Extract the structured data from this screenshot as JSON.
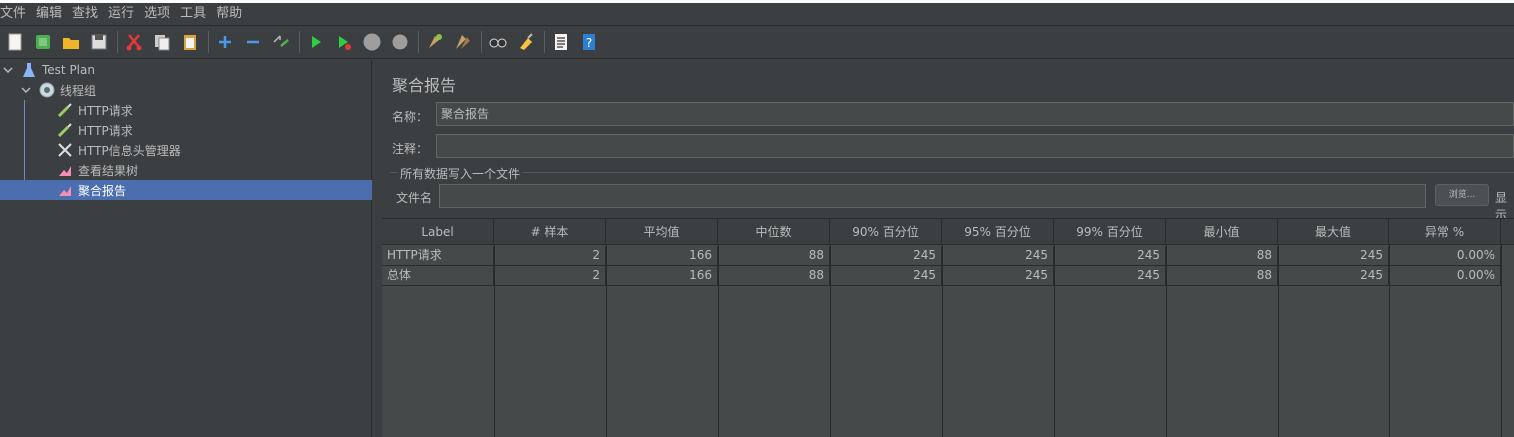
{
  "menu": [
    "文件",
    "编辑",
    "查找",
    "运行",
    "选项",
    "工具",
    "帮助"
  ],
  "toolbar": {
    "icons": [
      "new-icon",
      "templates-icon",
      "open-icon",
      "save-icon",
      "cut-icon",
      "copy-icon",
      "paste-icon",
      "expand-icon",
      "collapse-icon",
      "toggle-icon",
      "start-icon",
      "start-no-pauses-icon",
      "stop-icon",
      "shutdown-icon",
      "clear-icon",
      "clear-all-icon",
      "search-icon",
      "reset-search-icon",
      "function-helper-icon",
      "help-icon"
    ]
  },
  "tree": {
    "items": [
      {
        "label": "Test Plan"
      },
      {
        "label": "线程组"
      },
      {
        "label": "HTTP请求"
      },
      {
        "label": "HTTP请求"
      },
      {
        "label": "HTTP信息头管理器"
      },
      {
        "label": "查看结果树"
      },
      {
        "label": "聚合报告"
      }
    ]
  },
  "panel": {
    "title": "聚合报告",
    "name_label": "名称：",
    "name_value": "聚合报告",
    "comment_label": "注释：",
    "comment_value": "",
    "group_title": "所有数据写入一个文件",
    "filename_label": "文件名",
    "filename_value": "",
    "browse_label": "浏览...",
    "display_label": "显示"
  },
  "table": {
    "headers": [
      "Label",
      "# 样本",
      "平均值",
      "中位数",
      "90% 百分位",
      "95% 百分位",
      "99% 百分位",
      "最小值",
      "最大值",
      "异常 %"
    ],
    "rows": [
      [
        "HTTP请求",
        "2",
        "166",
        "88",
        "245",
        "245",
        "245",
        "88",
        "245",
        "0.00%"
      ],
      [
        "总体",
        "2",
        "166",
        "88",
        "245",
        "245",
        "245",
        "88",
        "245",
        "0.00%"
      ]
    ]
  },
  "colors": {
    "background": "#3c3f41",
    "selection": "#4b6eaf",
    "table_bg": "#45494a",
    "text": "#bbbbbb"
  }
}
